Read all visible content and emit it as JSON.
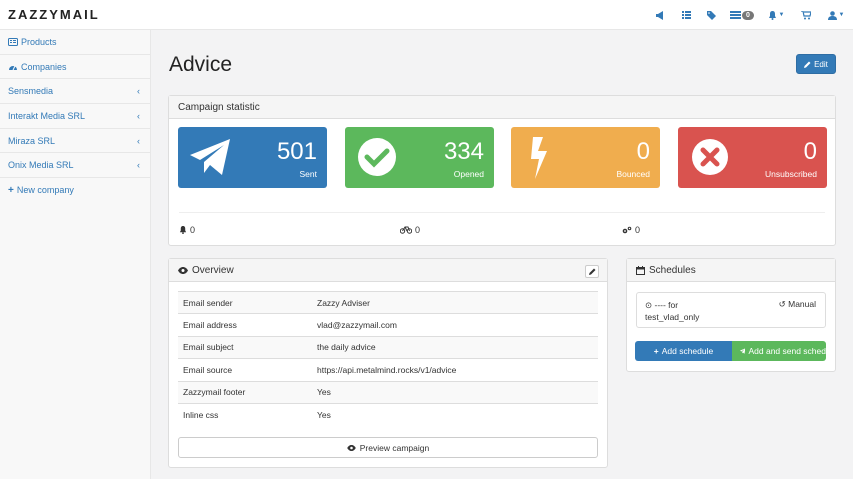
{
  "app": {
    "logo": "ZAZZYMAIL"
  },
  "navbar": {
    "badge_count": "0"
  },
  "sidebar": {
    "items": [
      {
        "label": "Products",
        "icon": "list-icon"
      },
      {
        "label": "Companies",
        "icon": "dashboard-icon"
      },
      {
        "label": "Sensmedia"
      },
      {
        "label": "Interakt Media SRL"
      },
      {
        "label": "Miraza SRL"
      },
      {
        "label": "Onix Media SRL"
      }
    ],
    "new_company": "New company"
  },
  "page": {
    "title": "Advice",
    "edit_label": "Edit"
  },
  "campaign_statistic": {
    "heading": "Campaign statistic",
    "stats": [
      {
        "value": "501",
        "label": "Sent",
        "color": "#337ab7"
      },
      {
        "value": "334",
        "label": "Opened",
        "color": "#5cb85c"
      },
      {
        "value": "0",
        "label": "Bounced",
        "color": "#f0ad4e"
      },
      {
        "value": "0",
        "label": "Unsubscribed",
        "color": "#d9534f"
      }
    ],
    "mini": [
      {
        "value": "0"
      },
      {
        "value": "0"
      },
      {
        "value": "0"
      }
    ]
  },
  "overview": {
    "heading": "Overview",
    "rows": [
      {
        "key": "Email sender",
        "value": "Zazzy Adviser"
      },
      {
        "key": "Email address",
        "value": "vlad@zazzymail.com"
      },
      {
        "key": "Email subject",
        "value": "the daily advice"
      },
      {
        "key": "Email source",
        "value": "https://api.metalmind.rocks/v1/advice"
      },
      {
        "key": "Zazzymail footer",
        "value": "Yes"
      },
      {
        "key": "Inline css",
        "value": "Yes"
      }
    ],
    "preview_label": "Preview campaign"
  },
  "schedules": {
    "heading": "Schedules",
    "item": {
      "line1": "---- for",
      "line2": "test_vlad_only",
      "type": "Manual"
    },
    "add_label": "Add schedule",
    "add_send_label": "Add and send sched"
  }
}
